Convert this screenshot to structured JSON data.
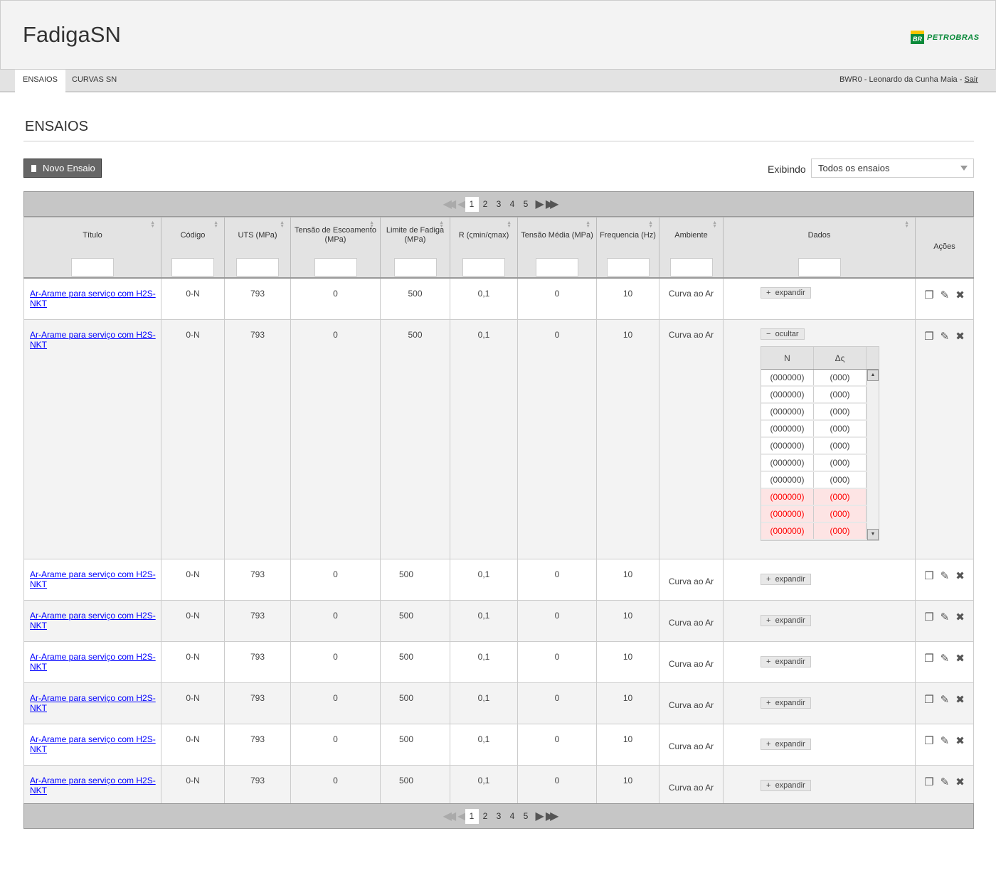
{
  "app": {
    "title": "FadigaSN",
    "logo_text": "PETROBRAS",
    "logo_mark": "BR"
  },
  "nav": {
    "tabs": [
      {
        "label": "ENSAIOS",
        "active": true
      },
      {
        "label": "CURVAS SN",
        "active": false
      }
    ],
    "user": "BWR0 - Leonardo da Cunha Maia - ",
    "logout": "Sair"
  },
  "page": {
    "title": "ENSAIOS",
    "new_button": "Novo Ensaio",
    "filter_label": "Exibindo",
    "filter_value": "Todos os ensaios"
  },
  "pager": {
    "pages": [
      "1",
      "2",
      "3",
      "4",
      "5"
    ],
    "current": "1"
  },
  "columns": [
    "Título",
    "Código",
    "UTS (MPa)",
    "Tensão de Escoamento (MPa)",
    "Limite de Fadiga (MPa)",
    "R (ςmin/ςmax)",
    "Tensão Média (MPa)",
    "Frequencia (Hz)",
    "Ambiente",
    "Dados",
    "Ações"
  ],
  "rows": [
    {
      "titulo": "Ar-Arame para serviço com H2S-NKT",
      "codigo": "0-N",
      "uts": "793",
      "escoamento": "0",
      "limite": "500",
      "r": "0,1",
      "media": "0",
      "freq": "10",
      "ambiente": "Curva ao Ar",
      "dados": "expandir"
    },
    {
      "titulo": "Ar-Arame para serviço com H2S-NKT",
      "codigo": "0-N",
      "uts": "793",
      "escoamento": "0",
      "limite": "500",
      "r": "0,1",
      "media": "0",
      "freq": "10",
      "ambiente": "Curva ao Ar",
      "dados": "ocultar",
      "expanded": true
    },
    {
      "titulo": "Ar-Arame para serviço com H2S-NKT",
      "codigo": "0-N",
      "uts": "793",
      "escoamento": "0",
      "limite": "500",
      "r": "0,1",
      "media": "0",
      "freq": "10",
      "ambiente": "Curva ao Ar",
      "dados": "expandir"
    },
    {
      "titulo": "Ar-Arame para serviço com H2S-NKT",
      "codigo": "0-N",
      "uts": "793",
      "escoamento": "0",
      "limite": "500",
      "r": "0,1",
      "media": "0",
      "freq": "10",
      "ambiente": "Curva ao Ar",
      "dados": "expandir"
    },
    {
      "titulo": "Ar-Arame para serviço com H2S-NKT",
      "codigo": "0-N",
      "uts": "793",
      "escoamento": "0",
      "limite": "500",
      "r": "0,1",
      "media": "0",
      "freq": "10",
      "ambiente": "Curva ao Ar",
      "dados": "expandir"
    },
    {
      "titulo": "Ar-Arame para serviço com H2S-NKT",
      "codigo": "0-N",
      "uts": "793",
      "escoamento": "0",
      "limite": "500",
      "r": "0,1",
      "media": "0",
      "freq": "10",
      "ambiente": "Curva ao Ar",
      "dados": "expandir"
    },
    {
      "titulo": "Ar-Arame para serviço com H2S-NKT",
      "codigo": "0-N",
      "uts": "793",
      "escoamento": "0",
      "limite": "500",
      "r": "0,1",
      "media": "0",
      "freq": "10",
      "ambiente": "Curva ao Ar",
      "dados": "expandir"
    },
    {
      "titulo": "Ar-Arame para serviço com H2S-NKT",
      "codigo": "0-N",
      "uts": "793",
      "escoamento": "0",
      "limite": "500",
      "r": "0,1",
      "media": "0",
      "freq": "10",
      "ambiente": "Curva ao Ar",
      "dados": "expandir"
    }
  ],
  "detail": {
    "headers": [
      "N",
      "Δς"
    ],
    "rows": [
      {
        "n": "(000000)",
        "ds": "(000)",
        "error": false
      },
      {
        "n": "(000000)",
        "ds": "(000)",
        "error": false
      },
      {
        "n": "(000000)",
        "ds": "(000)",
        "error": false
      },
      {
        "n": "(000000)",
        "ds": "(000)",
        "error": false
      },
      {
        "n": "(000000)",
        "ds": "(000)",
        "error": false
      },
      {
        "n": "(000000)",
        "ds": "(000)",
        "error": false
      },
      {
        "n": "(000000)",
        "ds": "(000)",
        "error": false
      },
      {
        "n": "(000000)",
        "ds": "(000)",
        "error": true
      },
      {
        "n": "(000000)",
        "ds": "(000)",
        "error": true
      },
      {
        "n": "(000000)",
        "ds": "(000)",
        "error": true
      }
    ],
    "error_color": "#ff0000"
  },
  "colors": {
    "link": "#0000ff",
    "button": "#666666",
    "header_bg": "#f3f3f3",
    "brand_green": "#0a8a3a",
    "brand_yellow": "#f5c400"
  }
}
